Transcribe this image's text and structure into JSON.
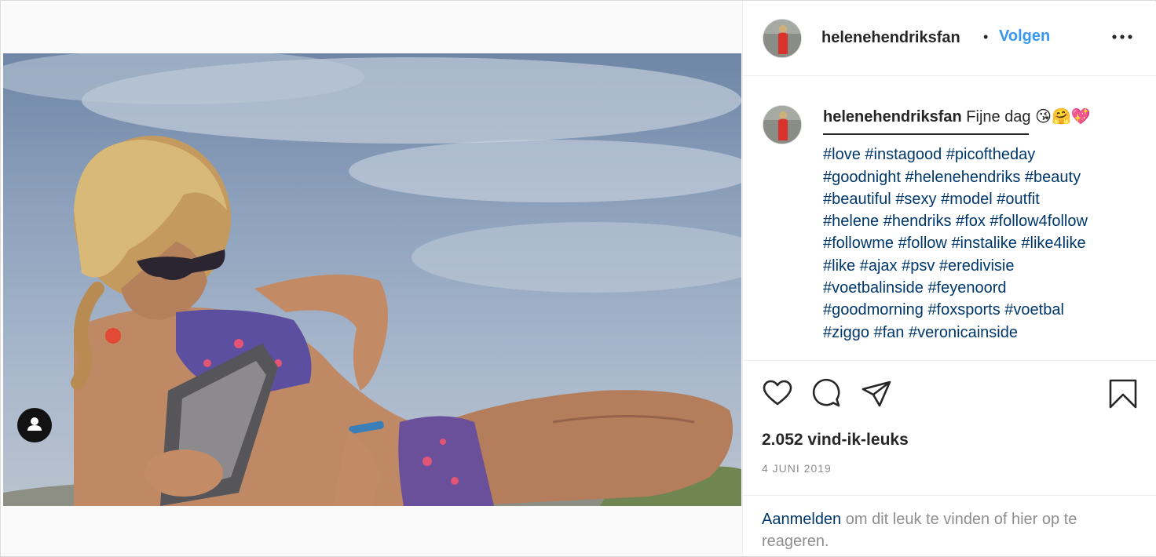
{
  "post": {
    "username": "helenehendriksfan",
    "separator": "•",
    "follow_label": "Volgen",
    "more_icon": "more-horizontal-icon"
  },
  "caption": {
    "username": "helenehendriksfan",
    "text": "Fijne dag 😘🤗💖",
    "tag_lines": [
      [
        "#love",
        "#instagood",
        "#picoftheday"
      ],
      [
        "#goodnight",
        "#helenehendriks",
        "#beauty"
      ],
      [
        "#beautiful",
        "#sexy",
        "#model",
        "#outfit"
      ],
      [
        "#helene",
        "#hendriks",
        "#fox",
        "#follow4follow"
      ],
      [
        "#followme",
        "#follow",
        "#instalike",
        "#like4like"
      ],
      [
        "#like",
        "#ajax",
        "#psv",
        "#eredivisie"
      ],
      [
        "#voetbalinside",
        "#feyenoord"
      ],
      [
        "#goodmorning",
        "#foxsports",
        "#voetbal"
      ],
      [
        "#ziggo",
        "#fan",
        "#veronicainside"
      ]
    ]
  },
  "actions": {
    "icons": [
      "heart-icon",
      "comment-icon",
      "share-icon",
      "bookmark-icon"
    ],
    "likes": "2.052 vind-ik-leuks",
    "date": "4 JUNI 2019"
  },
  "login": {
    "link_label": "Aanmelden",
    "text": " om dit leuk te vinden of hier op te reageren."
  },
  "colors": {
    "link": "#00376b",
    "follow": "#3897f0",
    "text": "#262626",
    "muted": "#8e8e8e"
  }
}
